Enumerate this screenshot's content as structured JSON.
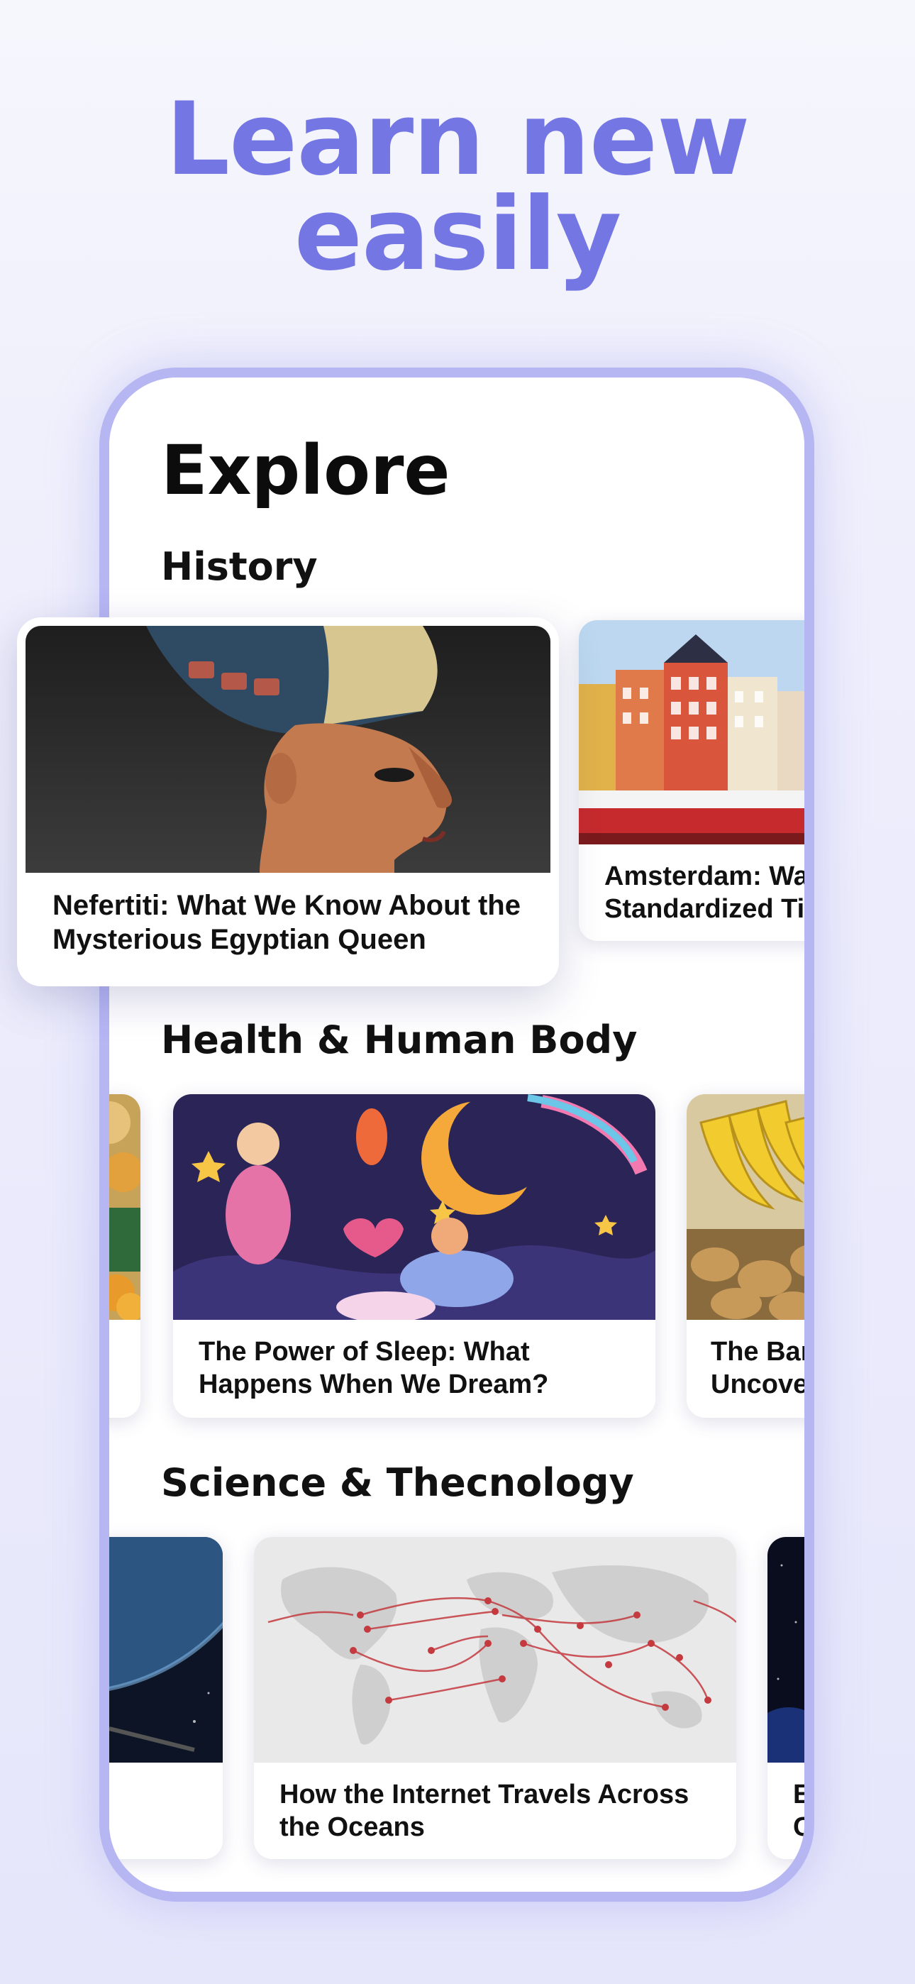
{
  "headline": {
    "line1": "Learn new",
    "line2": "easily"
  },
  "screen": {
    "title": "Explore",
    "sections": [
      {
        "title": "History",
        "cards": [
          {
            "caption": "Nefertiti: What We Know About the Mysterious Egyptian Queen",
            "image": "nefertiti-bust"
          },
          {
            "caption": "Amsterdam: Wate Standardized Tim",
            "image": "amsterdam-canal-houses"
          }
        ]
      },
      {
        "title": "Health & Human Body",
        "cards": [
          {
            "caption": "",
            "image": "fruits-basket"
          },
          {
            "caption": "The Power of Sleep: What Happens When We Dream?",
            "image": "dreaming-illustration"
          },
          {
            "caption": "The Ban Uncover",
            "image": "bananas-potatoes"
          }
        ]
      },
      {
        "title": "Science & Thecnology",
        "cards": [
          {
            "caption": "",
            "image": "earth-from-space"
          },
          {
            "caption": "How the Internet Travels Across the Oceans",
            "image": "submarine-cable-map"
          },
          {
            "caption": "E C",
            "image": "space-dark"
          }
        ]
      }
    ]
  },
  "colors": {
    "accent": "#7476e4",
    "frame": "#b6b6f3"
  }
}
